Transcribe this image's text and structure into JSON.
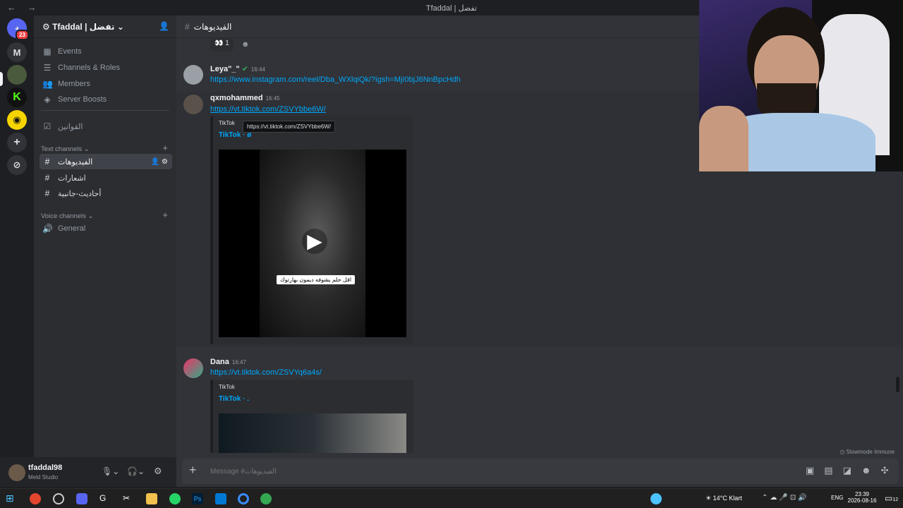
{
  "window": {
    "title": "Tfaddal | تفضل",
    "nav": "← →"
  },
  "rail": {
    "dm_badge": "23",
    "letter_server": "M"
  },
  "guild": {
    "name": "Tfaddal | تفضل"
  },
  "sidebar": {
    "items": [
      {
        "label": "Events",
        "icon": "calendar-icon"
      },
      {
        "label": "Channels & Roles",
        "icon": "list-icon"
      },
      {
        "label": "Members",
        "icon": "members-icon"
      },
      {
        "label": "Server Boosts",
        "icon": "boost-icon"
      }
    ],
    "rules_label": "القوانين",
    "text_category": "Text channels",
    "text_channels": [
      "الفيديوهات",
      "اشعارات",
      "أحاديث-جانبية"
    ],
    "voice_category": "Voice channels",
    "voice_channels": [
      "General"
    ]
  },
  "user": {
    "name": "tfaddal98",
    "status": "Meld Studio"
  },
  "channel": {
    "name": "الفيديوهات"
  },
  "messages": [
    {
      "reaction_emoji": "👀",
      "reaction_count": "1"
    },
    {
      "author": "Leya\"_\"",
      "time": "16:44",
      "content": "https://www.instagram.com/reel/Dba_WXlqiQk/?igsh=MjI0bjJ6NnBpcHdh"
    },
    {
      "author": "qxmohammed",
      "time": "16:45",
      "content": "https://vt.tiktok.com/ZSVYbbe6W/",
      "embed_provider": "TikTok",
      "embed_title": "TikTok · ø",
      "video_caption": "اقل حلم يشوفه ديمون بهارتوك",
      "tooltip": "https://vt.tiktok.com/ZSVYbbe6W/"
    },
    {
      "author": "Dana",
      "time": "16:47",
      "content": "https://vt.tiktok.com/ZSVYq6a4s/",
      "embed_provider": "TikTok",
      "embed_title": "TikTok · ."
    }
  ],
  "slowmode": "Slowmode Immune",
  "composer": {
    "placeholder": "Message #الفيديوهات"
  },
  "taskbar": {
    "weather": "14°C  Klart",
    "lang": "ENG",
    "time": "23:39",
    "date": "2026-08-16",
    "notif": "12"
  },
  "colors": {
    "accent": "#5865f2",
    "link": "#00a8fc",
    "bg_main": "#313338",
    "bg_side": "#2b2d31"
  }
}
